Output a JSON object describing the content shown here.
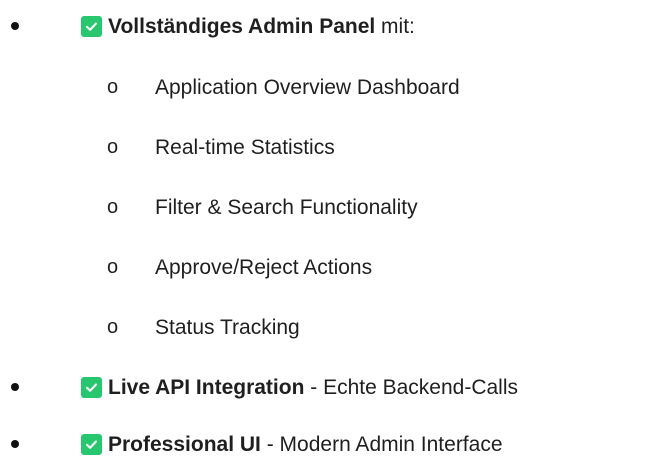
{
  "bullet_list": [
    {
      "bold": "Vollständiges Admin Panel",
      "rest": " mit:",
      "icon": "check-icon",
      "check_color": "#28c76f",
      "subitems": [
        "Application Overview Dashboard",
        "Real-time Statistics",
        "Filter & Search Functionality",
        "Approve/Reject Actions",
        "Status Tracking"
      ]
    },
    {
      "bold": "Live API Integration",
      "rest": " - Echte Backend-Calls",
      "icon": "check-icon",
      "check_color": "#28c76f"
    },
    {
      "bold": "Professional UI",
      "rest": " - Modern Admin Interface",
      "icon": "check-icon",
      "check_color": "#28c76f"
    }
  ],
  "sub_bullet_marker": "o"
}
